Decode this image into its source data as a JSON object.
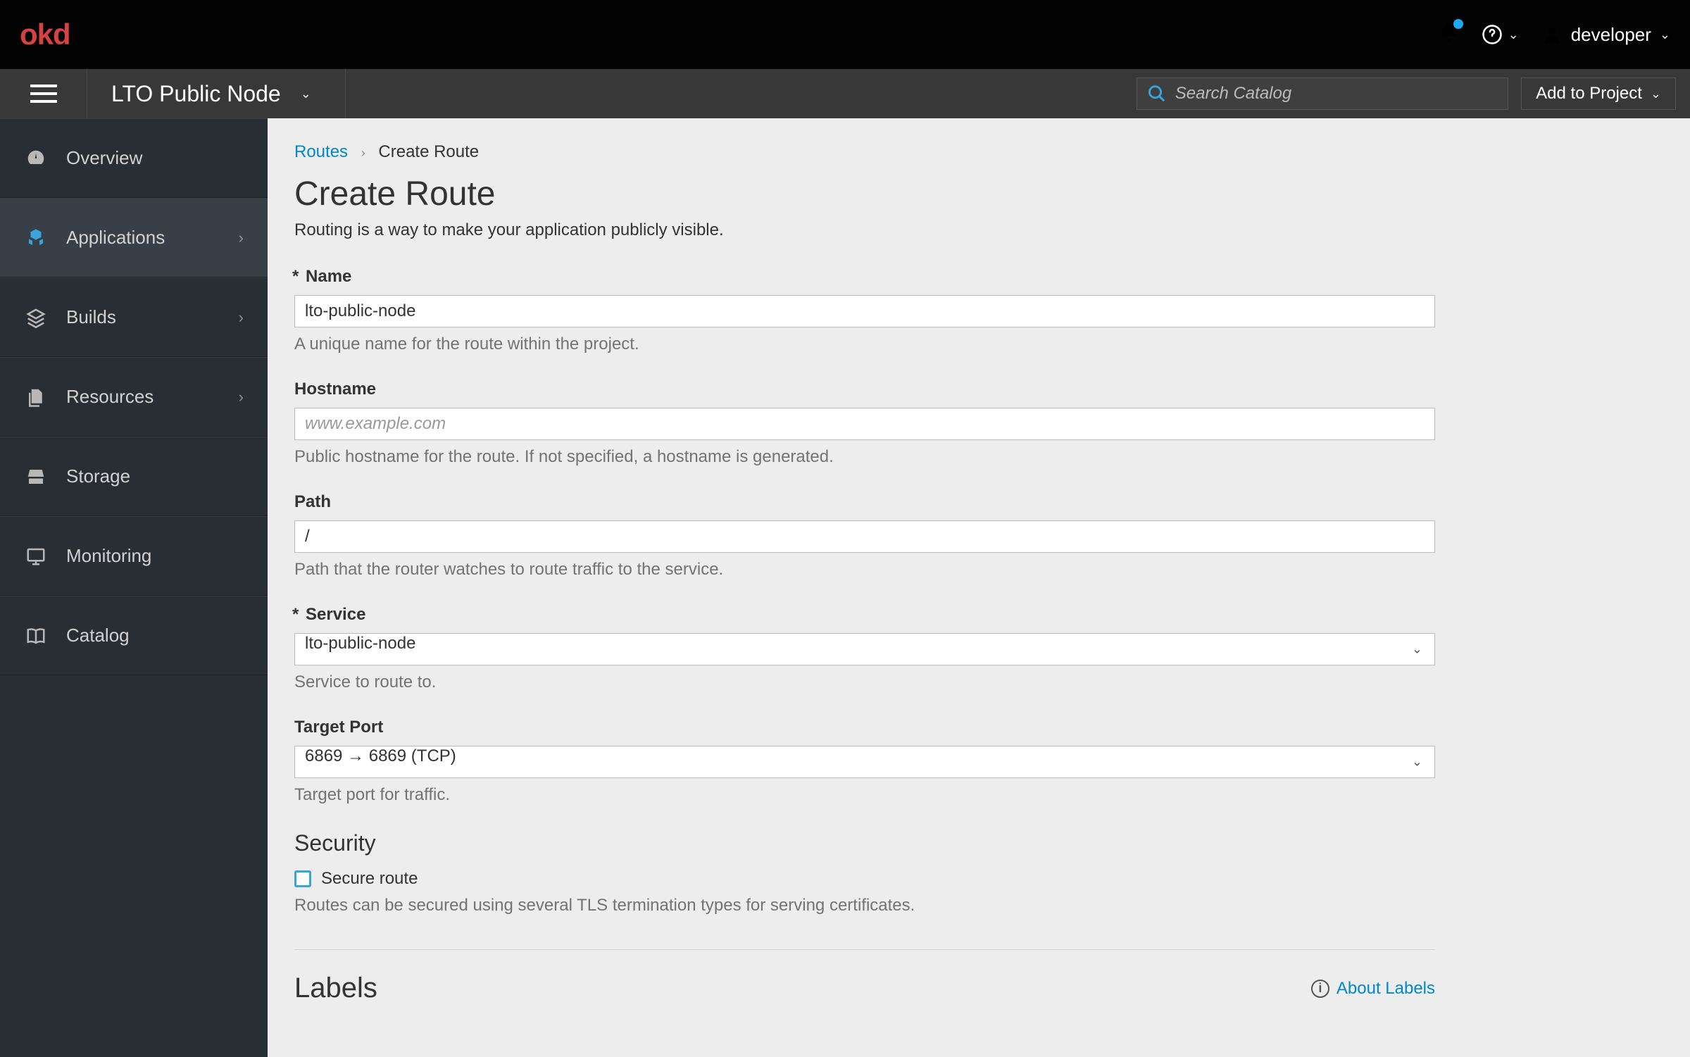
{
  "masthead": {
    "logo_text": "okd",
    "help_caret": "⌄",
    "user_label": "developer",
    "user_caret": "⌄"
  },
  "context": {
    "project_name": "LTO Public Node",
    "search_placeholder": "Search Catalog",
    "add_to_project_label": "Add to Project"
  },
  "sidebar": {
    "items": [
      {
        "label": "Overview",
        "has_chevron": false
      },
      {
        "label": "Applications",
        "has_chevron": true,
        "active": true
      },
      {
        "label": "Builds",
        "has_chevron": true
      },
      {
        "label": "Resources",
        "has_chevron": true
      },
      {
        "label": "Storage",
        "has_chevron": false
      },
      {
        "label": "Monitoring",
        "has_chevron": false
      },
      {
        "label": "Catalog",
        "has_chevron": false
      }
    ]
  },
  "breadcrumb": {
    "parent": "Routes",
    "current": "Create Route"
  },
  "page": {
    "title": "Create Route",
    "description": "Routing is a way to make your application publicly visible."
  },
  "form": {
    "name": {
      "label": "Name",
      "value": "lto-public-node",
      "help": "A unique name for the route within the project."
    },
    "hostname": {
      "label": "Hostname",
      "placeholder": "www.example.com",
      "help": "Public hostname for the route. If not specified, a hostname is generated."
    },
    "path": {
      "label": "Path",
      "value": "/",
      "help": "Path that the router watches to route traffic to the service."
    },
    "service": {
      "label": "Service",
      "value": "lto-public-node",
      "help": "Service to route to."
    },
    "target_port": {
      "label": "Target Port",
      "value": "6869 → 6869 (TCP)",
      "help": "Target port for traffic."
    },
    "security": {
      "heading": "Security",
      "checkbox_label": "Secure route",
      "help": "Routes can be secured using several TLS termination types for serving certificates."
    }
  },
  "labels": {
    "heading": "Labels",
    "about_link": "About Labels"
  }
}
